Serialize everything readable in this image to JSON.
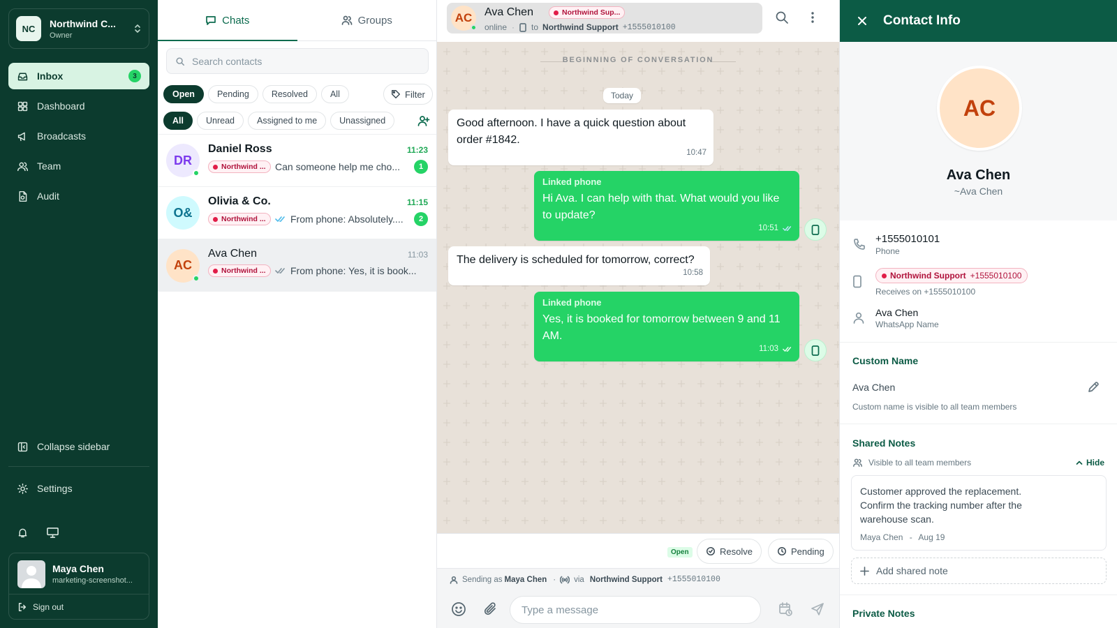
{
  "workspace": {
    "logo": "NC",
    "name": "Northwind C...",
    "role": "Owner"
  },
  "nav": [
    {
      "label": "Inbox",
      "icon": "inbox-icon",
      "badge": "3",
      "active": true
    },
    {
      "label": "Dashboard",
      "icon": "dashboard-icon"
    },
    {
      "label": "Broadcasts",
      "icon": "megaphone-icon"
    },
    {
      "label": "Team",
      "icon": "team-icon"
    },
    {
      "label": "Audit",
      "icon": "audit-icon"
    }
  ],
  "sidebar_bottom": {
    "collapse": "Collapse sidebar",
    "settings": "Settings"
  },
  "user": {
    "name": "Maya Chen",
    "email": "marketing-screenshot...",
    "signout": "Sign out"
  },
  "chatlist": {
    "tabs": [
      "Chats",
      "Groups"
    ],
    "search_placeholder": "Search contacts",
    "status_filters": [
      "Open",
      "Pending",
      "Resolved",
      "All"
    ],
    "filter_label": "Filter",
    "assign_filters": [
      "All",
      "Unread",
      "Assigned to me",
      "Unassigned"
    ],
    "chats": [
      {
        "initials": "DR",
        "name": "Daniel Ross",
        "time": "11:23",
        "tag": "Northwind ...",
        "preview": "Can someone help me cho...",
        "unread": "1"
      },
      {
        "initials": "O&",
        "name": "Olivia & Co.",
        "time": "11:15",
        "tag": "Northwind ...",
        "preview": "From phone: Absolutely....",
        "unread": "2"
      },
      {
        "initials": "AC",
        "name": "Ava Chen",
        "time": "11:03",
        "tag": "Northwind ...",
        "preview": "From phone: Yes, it is book..."
      }
    ]
  },
  "conversation": {
    "contact_initials": "AC",
    "contact_name": "Ava Chen",
    "channel_tag": "Northwind Sup...",
    "presence": "online",
    "to_label": "to",
    "channel_name": "Northwind Support",
    "channel_number": "+1555010100",
    "beginning": "BEGINNING OF CONVERSATION",
    "day_label": "Today",
    "messages": [
      {
        "direction": "in",
        "text": "Good afternoon. I have a quick question about order #1842.",
        "time": "10:47"
      },
      {
        "direction": "out",
        "sender": "Linked phone",
        "text": "Hi Ava. I can help with that. What would you like to update?",
        "time": "10:51"
      },
      {
        "direction": "in",
        "text": "The delivery is scheduled for tomorrow, correct?",
        "time": "10:58"
      },
      {
        "direction": "out",
        "sender": "Linked phone",
        "text": "Yes, it is booked for tomorrow between 9 and 11 AM.",
        "time": "11:03"
      }
    ],
    "status": "Open",
    "resolve_label": "Resolve",
    "pending_label": "Pending",
    "sending_prefix": "Sending as",
    "sending_user": "Maya Chen",
    "via": "via",
    "via_channel": "Northwind Support",
    "via_number": "+1555010100",
    "input_placeholder": "Type a message"
  },
  "contact_info": {
    "title": "Contact Info",
    "initials": "AC",
    "name": "Ava Chen",
    "whatsapp_display": "~Ava Chen",
    "phone": "+1555010101",
    "phone_label": "Phone",
    "channel_name": "Northwind Support",
    "channel_number": "+1555010100",
    "receives_on": "Receives on +1555010100",
    "wa_name": "Ava Chen",
    "wa_name_label": "WhatsApp Name",
    "custom_name_title": "Custom Name",
    "custom_name": "Ava Chen",
    "custom_name_hint": "Custom name is visible to all team members",
    "shared_notes_title": "Shared Notes",
    "shared_visibility": "Visible to all team members",
    "hide_label": "Hide",
    "note_text": "Customer approved the replacement. Confirm the tracking number after the warehouse scan.",
    "note_author": "Maya Chen",
    "note_sep": "-",
    "note_date": "Aug 19",
    "add_note": "Add shared note",
    "private_notes_title": "Private Notes"
  },
  "colors": {
    "brand_dark": "#0c3b2e",
    "accent": "#25d366",
    "header": "#0c5b45",
    "tag": "#e11d48"
  }
}
